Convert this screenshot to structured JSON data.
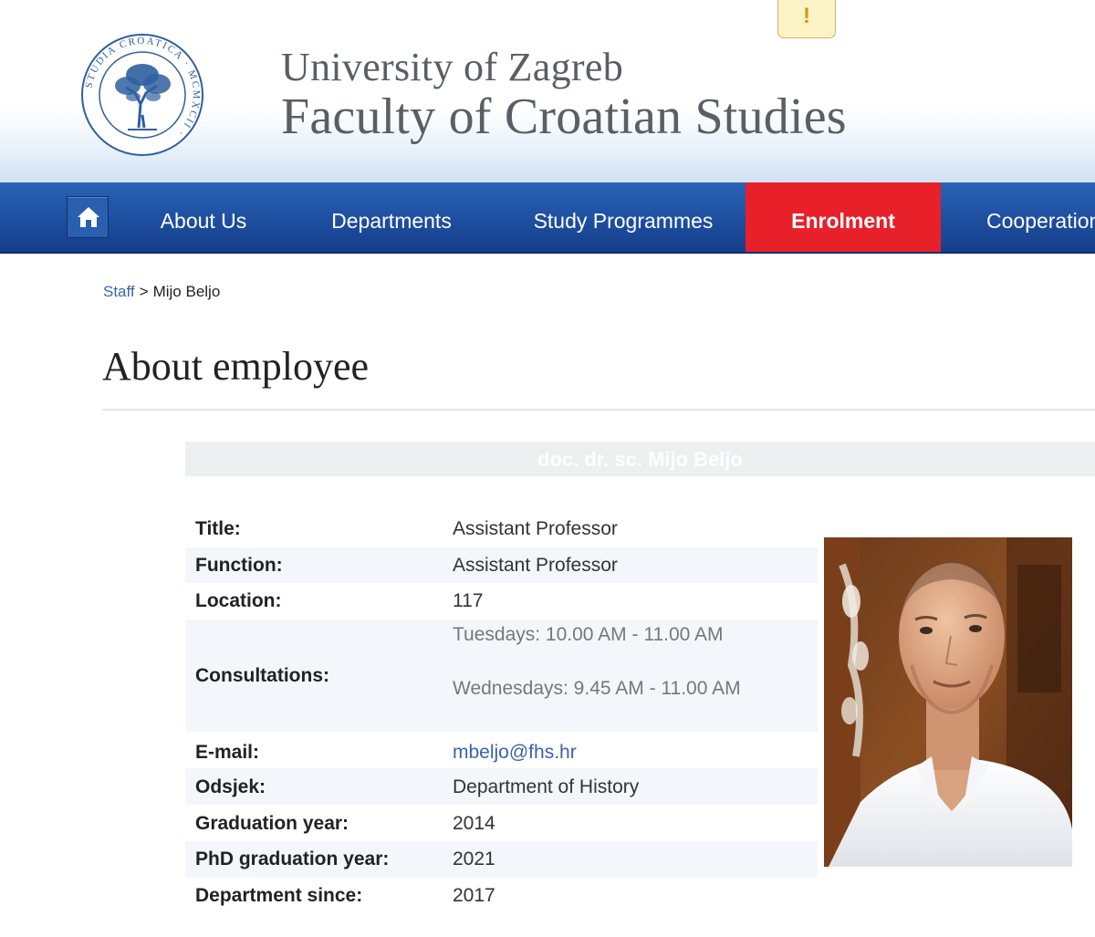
{
  "header": {
    "university": "University of Zagreb",
    "faculty": "Faculty of Croatian Studies",
    "seal_text": "STUDIA CROATICA MCMXCII",
    "warning_glyph": "!"
  },
  "nav": {
    "items": [
      {
        "label": "About Us"
      },
      {
        "label": "Departments"
      },
      {
        "label": "Study Programmes"
      },
      {
        "label": "Enrolment",
        "active": true
      },
      {
        "label": "Cooperation"
      }
    ],
    "colors": {
      "bar": "#1e4ea0",
      "active": "#e8202a"
    }
  },
  "breadcrumb": {
    "parent": "Staff",
    "separator": ">",
    "current": "Mijo Beljo"
  },
  "page": {
    "title": "About employee",
    "employee_name": "doc. dr. sc. Mijo Beljo"
  },
  "details": [
    {
      "label": "Title:",
      "value": "Assistant Professor"
    },
    {
      "label": "Function:",
      "value": "Assistant Professor"
    },
    {
      "label": "Location:",
      "value": "117"
    },
    {
      "label": "Consultations:",
      "values": [
        "Tuesdays: 10.00 AM - 11.00 AM",
        "Wednesdays: 9.45 AM - 11.00 AM"
      ]
    },
    {
      "label": "E-mail:",
      "value": "mbeljo@fhs.hr"
    },
    {
      "label": "Odsjek:",
      "value": "Department of History"
    },
    {
      "label": "Graduation year:",
      "value": "2014"
    },
    {
      "label": "PhD graduation year:",
      "value": "2021"
    },
    {
      "label": "Department since:",
      "value": "2017"
    }
  ]
}
